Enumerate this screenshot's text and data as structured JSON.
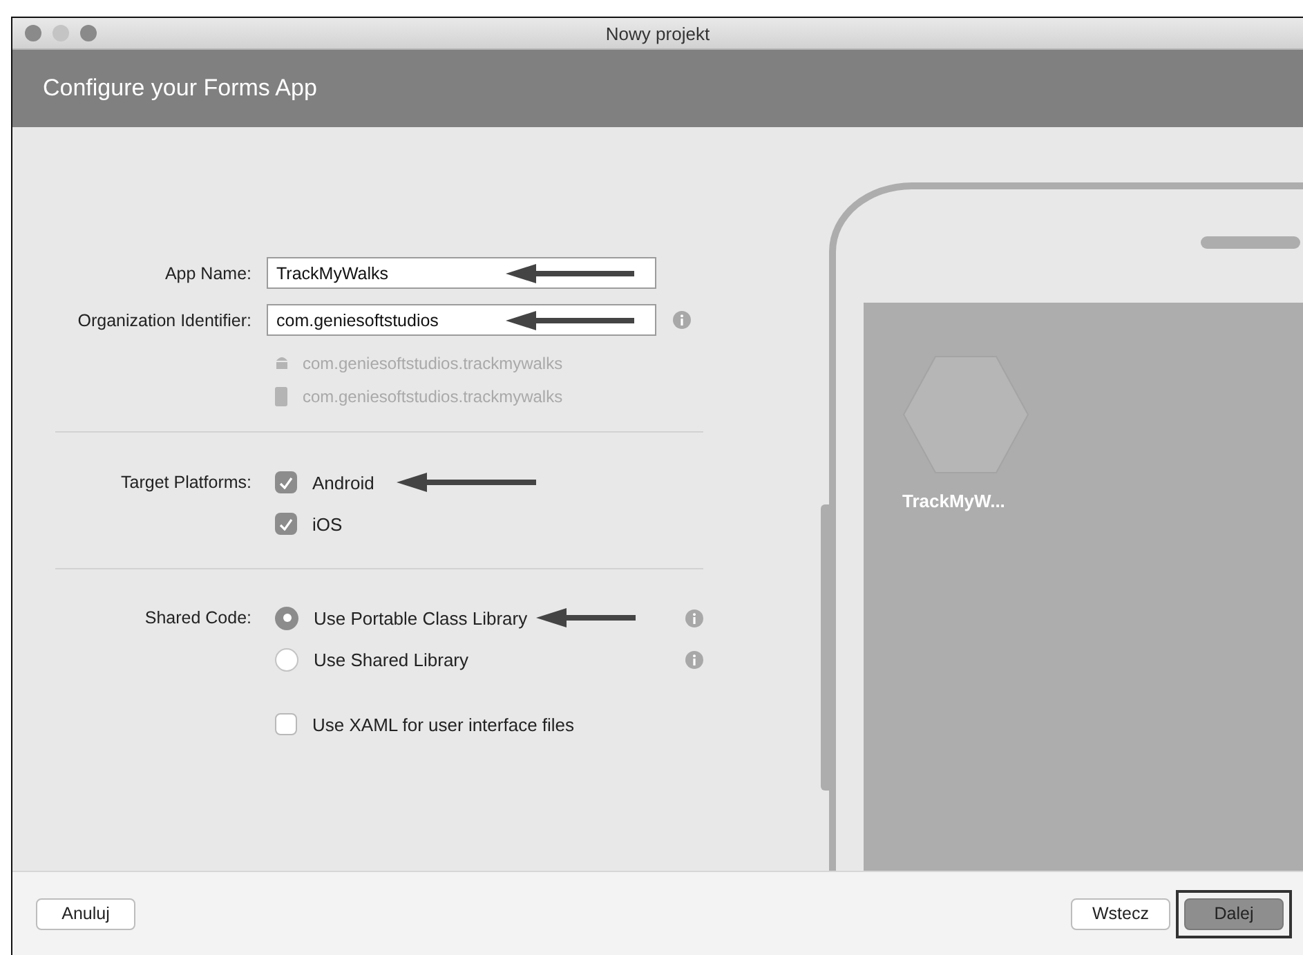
{
  "window": {
    "title": "Nowy projekt"
  },
  "header": {
    "title": "Configure your Forms App"
  },
  "fields": [
    {
      "label": "App Name:",
      "value": "TrackMyWalks",
      "info": false,
      "arrow": true
    },
    {
      "label": "Organization Identifier:",
      "value": "com.geniesoftstudios",
      "info": true,
      "arrow": true
    }
  ],
  "package_ids": [
    {
      "kind": "android",
      "text": "com.geniesoftstudios.trackmywalks"
    },
    {
      "kind": "ios",
      "text": "com.geniesoftstudios.trackmywalks"
    }
  ],
  "target_platforms": {
    "label": "Target Platforms:",
    "items": [
      {
        "label": "Android",
        "checked": true,
        "arrow": true
      },
      {
        "label": "iOS",
        "checked": true,
        "arrow": false
      }
    ]
  },
  "shared_code": {
    "label": "Shared Code:",
    "options": [
      {
        "label": "Use Portable Class Library",
        "selected": true,
        "info": true,
        "arrow": true
      },
      {
        "label": "Use Shared Library",
        "selected": false,
        "info": true,
        "arrow": false
      }
    ]
  },
  "xaml_option": {
    "label": "Use XAML for user interface files",
    "checked": false
  },
  "preview": {
    "app_label": "TrackMyW..."
  },
  "buttons": [
    {
      "label": "Anuluj",
      "kind": "cancel",
      "highlighted": false
    },
    {
      "label": "Wstecz",
      "kind": "back",
      "highlighted": false
    },
    {
      "label": "Dalej",
      "kind": "next",
      "highlighted": true
    }
  ]
}
